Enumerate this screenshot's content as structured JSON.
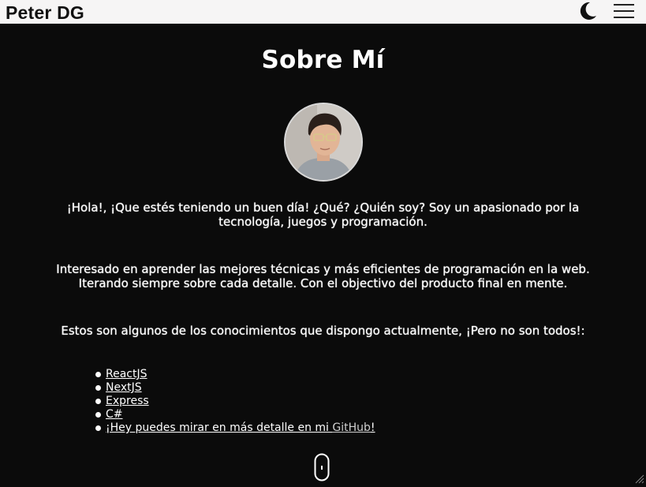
{
  "header": {
    "brand": "Peter DG",
    "theme_icon": "moon-icon",
    "menu_icon": "hamburger-menu-icon"
  },
  "about": {
    "title": "Sobre Mí",
    "avatar_icon": "profile-photo",
    "paragraphs": [
      "¡Hola!, ¡Que estés teniendo un buen día! ¿Qué? ¿Quién soy? Soy un apasionado por la tecnología, juegos y programación.",
      "Interesado en aprender las mejores técnicas y más eficientes de programación en la web. Iterando siempre sobre cada detalle. Con el objectivo del producto final en mente.",
      "Estos son algunos de los conocimientos que dispongo actualmente, ¡Pero no son todos!:"
    ],
    "skills": [
      "ReactJS",
      "NextJS",
      "Express",
      "C#"
    ],
    "more_text": "¡Hey puedes mirar en más detalle en mi ",
    "github_link": "GitHub",
    "more_suffix": "!",
    "scroll_icon": "mouse-scroll-icon"
  },
  "colors": {
    "background": "#0b0b0b",
    "header_bg": "#f6f5f5",
    "text": "#ffffff"
  }
}
